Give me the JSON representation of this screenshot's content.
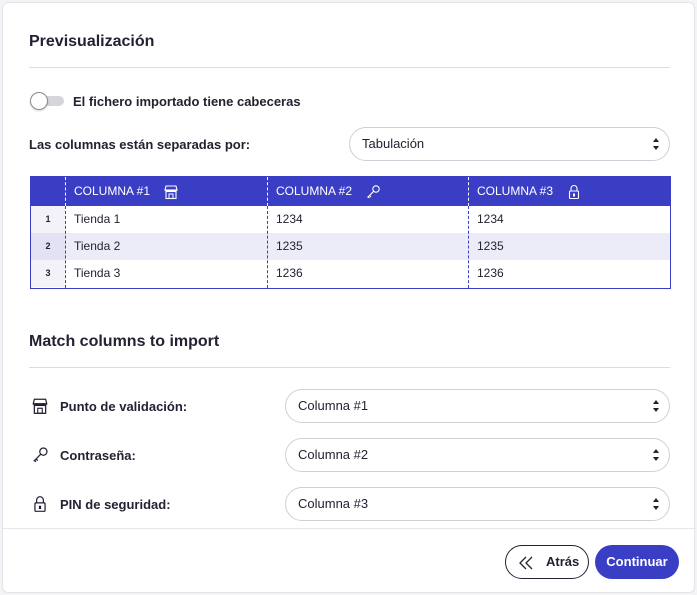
{
  "preview": {
    "title": "Previsualización",
    "headers_toggle_label": "El fichero importado tiene cabeceras",
    "headers_toggle_on": false,
    "separator_label": "Las columnas están separadas por:",
    "separator_value": "Tabulación"
  },
  "table": {
    "headers": [
      {
        "label": "COLUMNA #1",
        "icon": "store-icon"
      },
      {
        "label": "COLUMNA #2",
        "icon": "key-icon"
      },
      {
        "label": "COLUMNA #3",
        "icon": "lock-icon"
      }
    ],
    "rows": [
      {
        "num": "1",
        "cells": [
          "Tienda 1",
          "1234",
          "1234"
        ]
      },
      {
        "num": "2",
        "cells": [
          "Tienda 2",
          "1235",
          "1235"
        ]
      },
      {
        "num": "3",
        "cells": [
          "Tienda 3",
          "1236",
          "1236"
        ]
      }
    ]
  },
  "match": {
    "title": "Match columns to import",
    "fields": [
      {
        "label": "Punto de validación:",
        "icon": "store-icon",
        "value": "Columna #1"
      },
      {
        "label": "Contraseña:",
        "icon": "key-icon",
        "value": "Columna #2"
      },
      {
        "label": "PIN de seguridad:",
        "icon": "lock-icon",
        "value": "Columna #3"
      }
    ]
  },
  "footer": {
    "back_label": "Atrás",
    "continue_label": "Continuar"
  },
  "colors": {
    "accent": "#3a3ec5",
    "row_alt": "#ececf9"
  }
}
